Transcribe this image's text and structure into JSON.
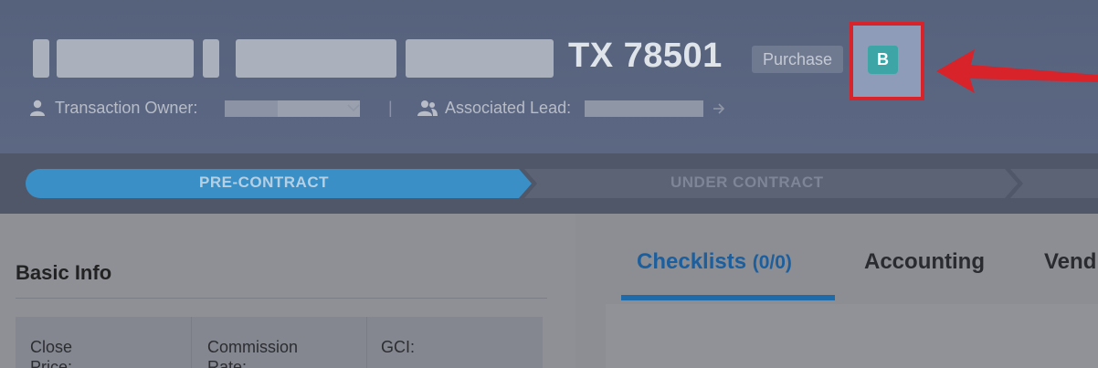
{
  "header": {
    "title_suffix": "TX 78501",
    "type_tag": "Purchase",
    "badge_letter": "B",
    "transaction_owner_label": "Transaction Owner:",
    "associated_lead_label": "Associated Lead:",
    "separator": "|"
  },
  "stages": [
    {
      "label": "PRE-CONTRACT",
      "active": true
    },
    {
      "label": "UNDER CONTRACT",
      "active": false
    }
  ],
  "basic_info": {
    "title": "Basic Info",
    "fields": [
      {
        "label_line1": "Close",
        "label_line2": "Price:"
      },
      {
        "label_line1": "Commission",
        "label_line2": "Rate:"
      },
      {
        "label_line1": "GCI:",
        "label_line2": ""
      }
    ]
  },
  "tabs": [
    {
      "label": "Checklists",
      "count": "(0/0)"
    },
    {
      "label": "Accounting"
    },
    {
      "label": "Vend"
    }
  ],
  "colors": {
    "highlight": "#d8232a",
    "badge": "#3ea5a7",
    "active_stage": "#3a8fc7",
    "active_tab": "#1d5e9c"
  }
}
